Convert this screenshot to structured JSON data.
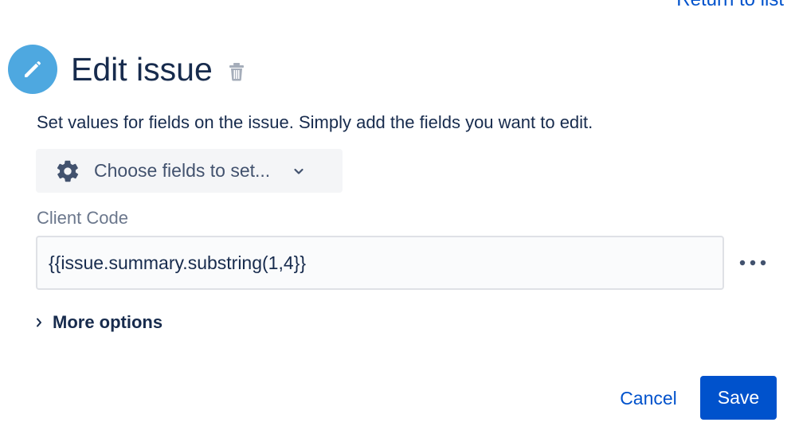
{
  "header": {
    "return_link": "Return to list",
    "title": "Edit issue",
    "icon": "pencil-icon",
    "delete_icon": "trash-icon"
  },
  "description": "Set values for fields on the issue. Simply add the fields you want to edit.",
  "field_chooser": {
    "label": "Choose fields to set...",
    "icon": "gear-icon",
    "dropdown_icon": "chevron-down-icon"
  },
  "fields": [
    {
      "label": "Client Code",
      "value": "{{issue.summary.substring(1,4}}",
      "actions_icon": "more-horizontal-icon"
    }
  ],
  "more_options": {
    "label": "More options",
    "icon": "chevron-right-icon"
  },
  "footer": {
    "cancel_label": "Cancel",
    "save_label": "Save"
  },
  "colors": {
    "primary": "#0052cc",
    "text": "#172b4d",
    "subtle_text": "#6b778c",
    "icon_circle": "#4ea8e0",
    "chooser_bg": "#f4f5f7"
  }
}
